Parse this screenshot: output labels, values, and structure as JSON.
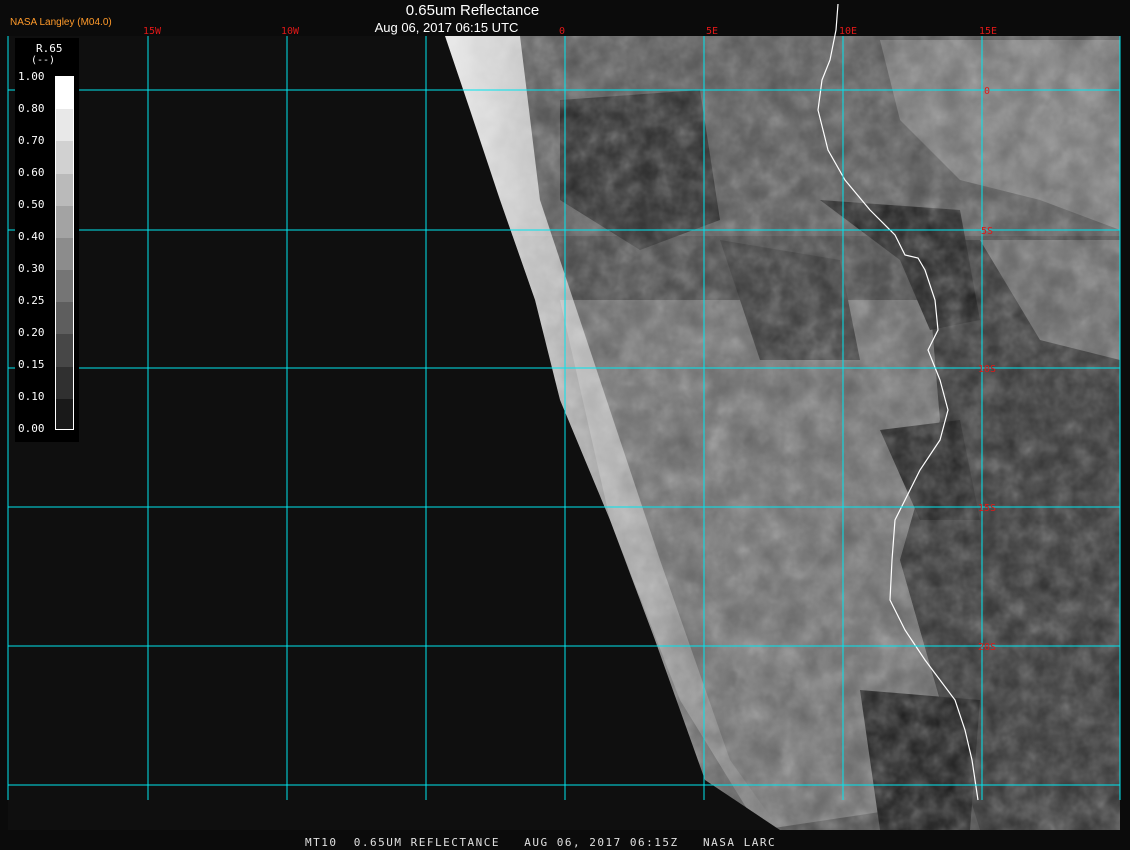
{
  "header": {
    "agency": "NASA Langley (M04.0)",
    "title": "0.65um Reflectance",
    "subtitle": "Aug 06, 2017 06:15 UTC"
  },
  "footer": {
    "caption": "MT10  0.65UM REFLECTANCE   AUG 06, 2017 06:15Z   NASA LARC"
  },
  "legend": {
    "name": "R.65",
    "unit": "(--)",
    "ticks": [
      "1.00",
      "0.80",
      "0.70",
      "0.60",
      "0.50",
      "0.40",
      "0.30",
      "0.25",
      "0.20",
      "0.15",
      "0.10",
      "0.00"
    ]
  },
  "grid": {
    "longitudes": [
      "15W",
      "10W",
      "0",
      "5E",
      "10E",
      "15E"
    ],
    "latitudes": [
      "0",
      "5S",
      "10S",
      "15S",
      "20S"
    ]
  },
  "colors": {
    "gridline": "#00e5ee",
    "grid_label": "#e01818",
    "coastline": "#ffffff",
    "agency": "#ff9a2a"
  }
}
